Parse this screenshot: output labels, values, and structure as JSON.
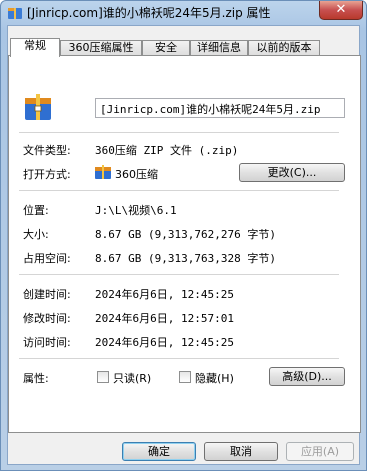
{
  "window": {
    "title": "[Jinricp.com]谁的小棉袄呢24年5月.zip 属性",
    "close_glyph": "✕"
  },
  "tabs": [
    {
      "label": "常规"
    },
    {
      "label": "360压缩属性"
    },
    {
      "label": "安全"
    },
    {
      "label": "详细信息"
    },
    {
      "label": "以前的版本"
    }
  ],
  "general": {
    "file_name": "[Jinricp.com]谁的小棉袄呢24年5月.zip",
    "type_label": "文件类型:",
    "type_value": "360压缩 ZIP 文件 (.zip)",
    "open_with_label": "打开方式:",
    "open_with_value": "360压缩",
    "change_button": "更改(C)...",
    "location_label": "位置:",
    "location_value": "J:\\L\\视频\\6.1",
    "size_label": "大小:",
    "size_value": "8.67 GB (9,313,762,276 字节)",
    "disk_size_label": "占用空间:",
    "disk_size_value": "8.67 GB (9,313,763,328 字节)",
    "created_label": "创建时间:",
    "created_value": "2024年6月6日, 12:45:25",
    "modified_label": "修改时间:",
    "modified_value": "2024年6月6日, 12:57:01",
    "accessed_label": "访问时间:",
    "accessed_value": "2024年6月6日, 12:45:25",
    "attributes_label": "属性:",
    "readonly_label": "只读(R)",
    "hidden_label": "隐藏(H)",
    "advanced_button": "高级(D)..."
  },
  "buttons": {
    "ok": "确定",
    "cancel": "取消",
    "apply": "应用(A)"
  },
  "colors": {
    "accent_border": "#3c7fb1",
    "close_red": "#c75050"
  }
}
